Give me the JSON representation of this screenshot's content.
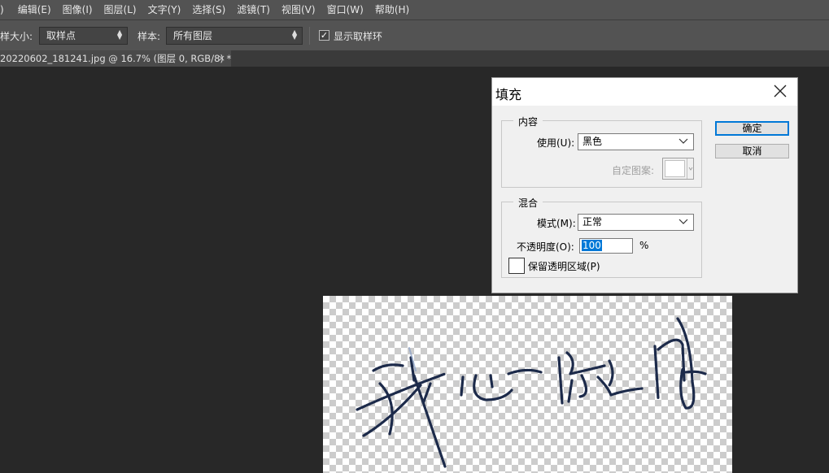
{
  "menu": [
    "编辑(E)",
    "图像(I)",
    "图层(L)",
    "文字(Y)",
    "选择(S)",
    "滤镜(T)",
    "视图(V)",
    "窗口(W)",
    "帮助(H)"
  ],
  "menu_lead": ")",
  "options": {
    "sample_size_label": "样大小:",
    "sample_size_value": "取样点",
    "sample_label": "样本:",
    "sample_value": "所有图层",
    "show_ring_label": "显示取样环",
    "show_ring_checked": true
  },
  "document_tab": {
    "title": "20220602_181241.jpg @ 16.7% (图层 0, RGB/8) *",
    "close": "×"
  },
  "dialog": {
    "title": "填充",
    "content_group": "内容",
    "use_label": "使用(U):",
    "use_value": "黑色",
    "custom_pattern_label": "自定图案:",
    "blend_group": "混合",
    "mode_label": "模式(M):",
    "mode_value": "正常",
    "opacity_label": "不透明度(O):",
    "opacity_value": "100",
    "opacity_unit": "%",
    "preserve_label": "保留透明区域(P)",
    "preserve_checked": false,
    "ok_label": "确定",
    "cancel_label": "取消"
  },
  "colors": {
    "app_bg": "#282828",
    "bar_bg": "#535353",
    "accent": "#0078d7",
    "ink": "#1c2a4a"
  }
}
